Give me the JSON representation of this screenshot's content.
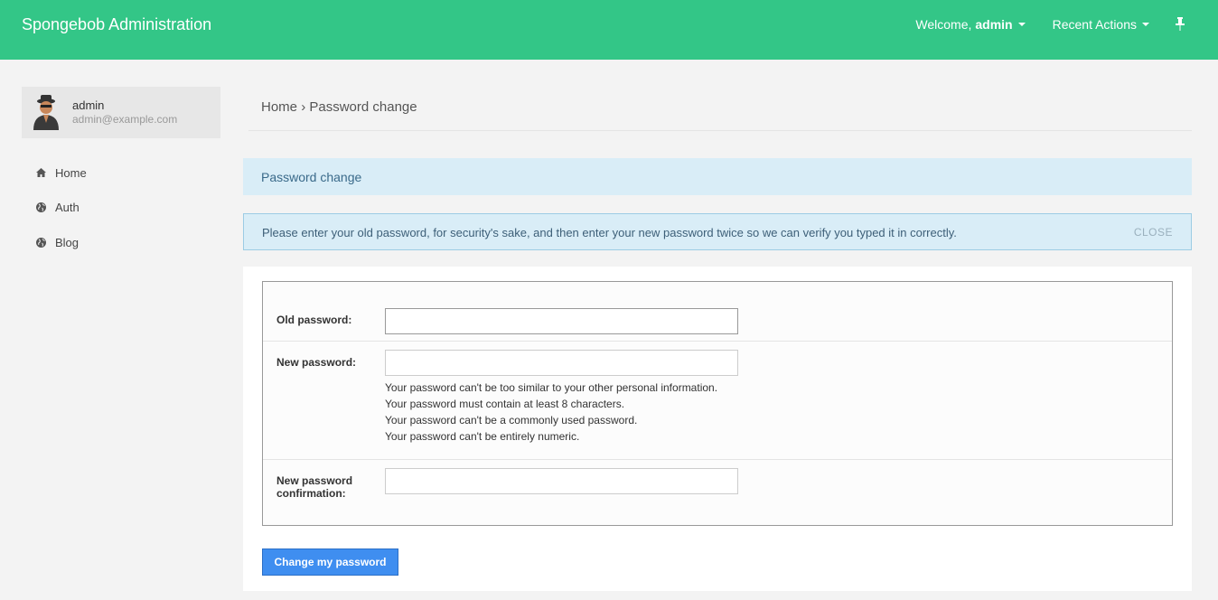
{
  "header": {
    "brand": "Spongebob Administration",
    "welcome_prefix": "Welcome,",
    "username": "admin",
    "recent_actions": "Recent Actions"
  },
  "user": {
    "name": "admin",
    "email": "admin@example.com"
  },
  "sidebar": {
    "items": [
      {
        "label": "Home",
        "icon": "home-icon"
      },
      {
        "label": "Auth",
        "icon": "globe-icon"
      },
      {
        "label": "Blog",
        "icon": "globe-icon"
      }
    ]
  },
  "breadcrumb": {
    "home": "Home",
    "separator": "›",
    "current": "Password change"
  },
  "page": {
    "title": "Password change",
    "alert": "Please enter your old password, for security's sake, and then enter your new password twice so we can verify you typed it in correctly.",
    "alert_close": "CLOSE"
  },
  "form": {
    "old_password_label": "Old password:",
    "new_password_label": "New password:",
    "confirm_label_line1": "New password",
    "confirm_label_line2": "confirmation:",
    "help": [
      "Your password can't be too similar to your other personal information.",
      "Your password must contain at least 8 characters.",
      "Your password can't be a commonly used password.",
      "Your password can't be entirely numeric."
    ],
    "submit": "Change my password"
  },
  "colors": {
    "topbar": "#33c687",
    "info_bg": "#d9edf7",
    "button": "#3f8ef0"
  }
}
